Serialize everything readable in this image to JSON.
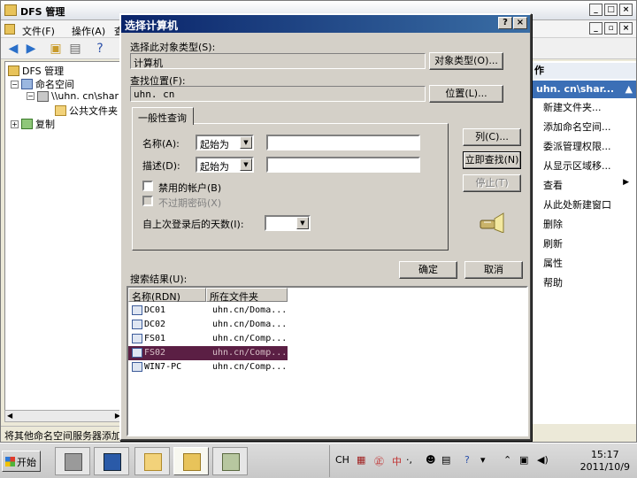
{
  "main_window": {
    "title": "DFS 管理",
    "menu": [
      "文件(F)",
      "操作(A)",
      "查"
    ],
    "tree": {
      "root": "DFS 管理",
      "namespaces": "命名空间",
      "namespace_item": "\\\\uhn. cn\\shar",
      "folder": "公共文件夹",
      "replication": "复制"
    },
    "status": "将其他命名空间服务器添加",
    "actions": {
      "header": "作",
      "selected": "uhn. cn\\shar...",
      "items": [
        "新建文件夹...",
        "添加命名空间...",
        "委派管理权限...",
        "从显示区域移...",
        "查看",
        "从此处新建窗口",
        "删除",
        "刷新",
        "属性",
        "帮助"
      ]
    }
  },
  "dialog": {
    "title": "选择计算机",
    "object_type_label": "选择此对象类型(S):",
    "object_type_value": "计算机",
    "object_type_button": "对象类型(O)...",
    "location_label": "查找位置(F):",
    "location_value": "uhn. cn",
    "location_button": "位置(L)...",
    "tab_label": "一般性查询",
    "name_label": "名称(A):",
    "name_combo": "起始为",
    "desc_label": "描述(D):",
    "desc_combo": "起始为",
    "disabled_accounts": "禁用的帐户(B)",
    "non_expiring": "不过期密码(X)",
    "days_label": "自上次登录后的天数(I):",
    "columns_button": "列(C)...",
    "find_now_button": "立即查找(N)",
    "stop_button": "停止(T)",
    "ok_button": "确定",
    "cancel_button": "取消",
    "results_label": "搜索结果(U):",
    "results_headers": [
      "名称(RDN)",
      "所在文件夹"
    ],
    "results": [
      {
        "name": "DC01",
        "folder": "uhn.cn/Doma..."
      },
      {
        "name": "DC02",
        "folder": "uhn.cn/Doma..."
      },
      {
        "name": "FS01",
        "folder": "uhn.cn/Comp..."
      },
      {
        "name": "FS02",
        "folder": "uhn.cn/Comp..."
      },
      {
        "name": "WIN7-PC",
        "folder": "uhn.cn/Comp..."
      }
    ]
  },
  "taskbar": {
    "start": "开始",
    "tray_lang": "CH",
    "tray_ime": "中",
    "time": "15:17",
    "date": "2011/10/9"
  }
}
